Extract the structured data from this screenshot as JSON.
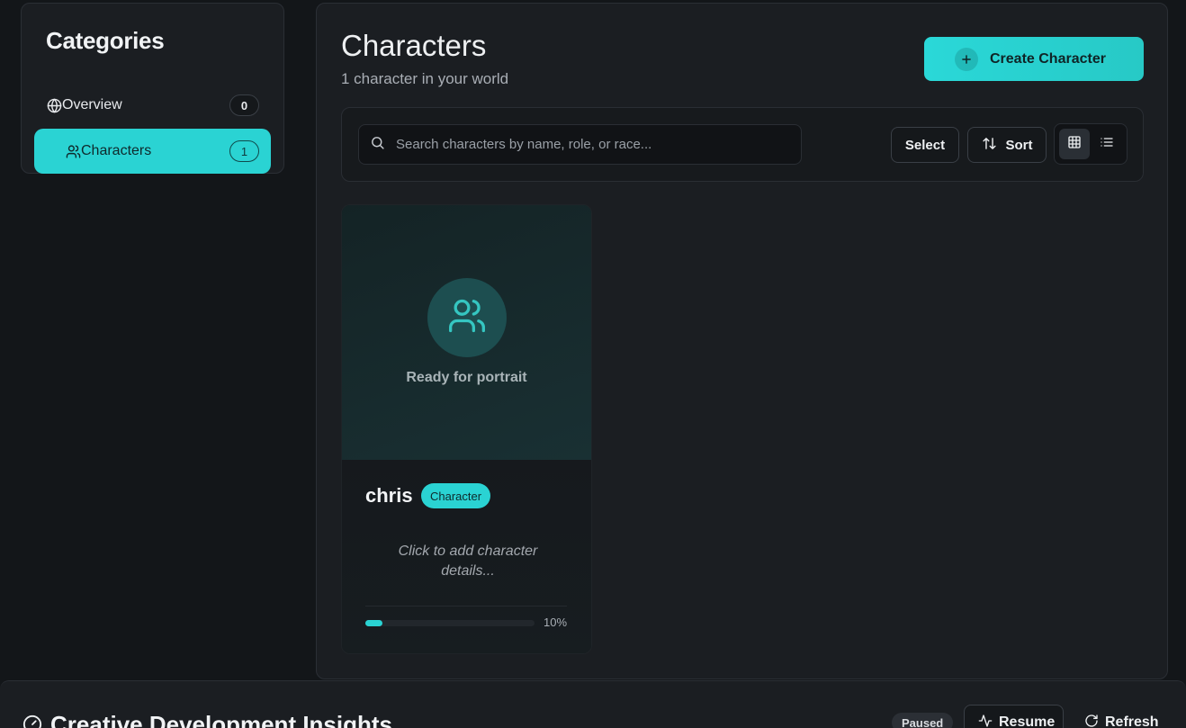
{
  "sidebar": {
    "title": "Categories",
    "items": [
      {
        "label": "Overview",
        "count": "0"
      },
      {
        "label": "Characters",
        "count": "1"
      }
    ]
  },
  "main": {
    "title": "Characters",
    "subtitle": "1 character in your world",
    "create_label": "Create Character"
  },
  "toolbar": {
    "search_placeholder": "Search characters by name, role, or race...",
    "select_label": "Select",
    "sort_label": "Sort",
    "view_modes": [
      "grid-icon",
      "list-icon"
    ]
  },
  "cards": [
    {
      "portrait_text": "Ready for portrait",
      "name": "chris",
      "tag": "Character",
      "details_prompt": "Click to add character details...",
      "progress": 0.1,
      "progress_label": "10%"
    }
  ],
  "insights": {
    "title": "Creative Development Insights",
    "status": "Paused",
    "resume_label": "Resume",
    "refresh_label": "Refresh"
  },
  "colors": {
    "accent": "#2ad3d3",
    "background": "#131619",
    "panel": "#1b1e22"
  }
}
